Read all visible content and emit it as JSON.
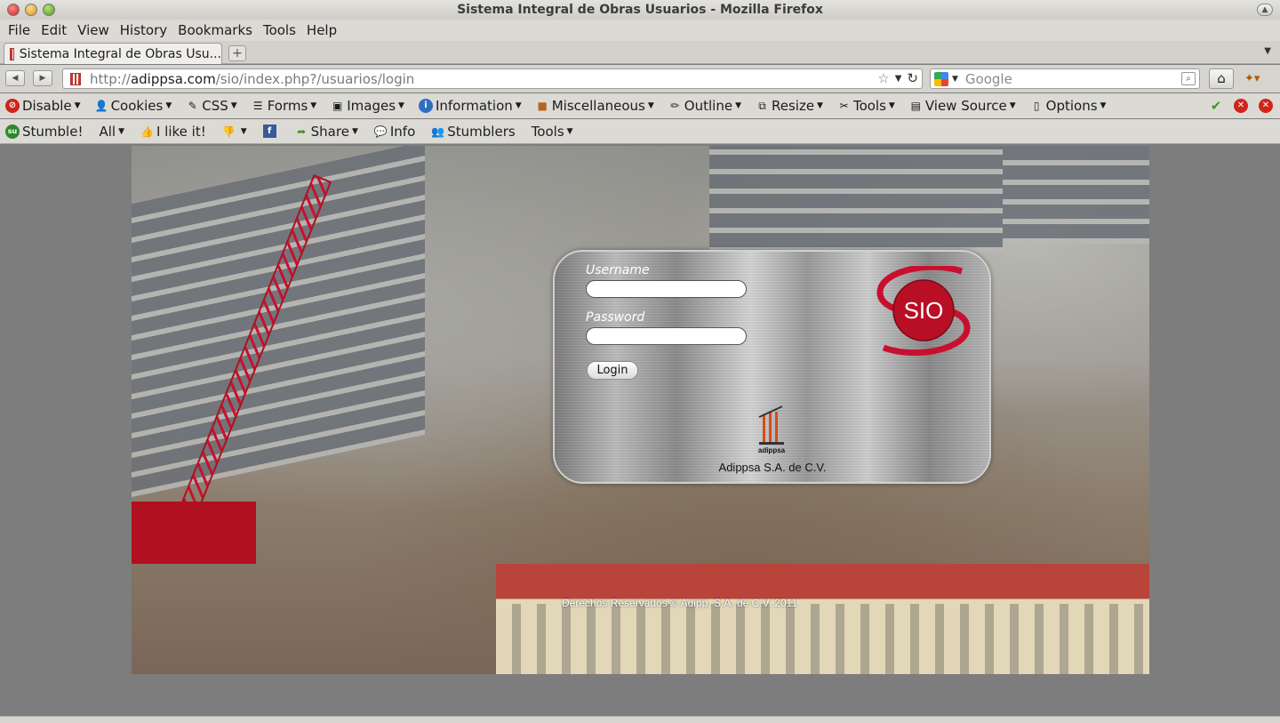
{
  "window": {
    "title": "Sistema Integral de Obras Usuarios - Mozilla Firefox"
  },
  "menu": [
    "File",
    "Edit",
    "View",
    "History",
    "Bookmarks",
    "Tools",
    "Help"
  ],
  "tab": {
    "label": "Sistema Integral de Obras Usu...",
    "new_tab": "+"
  },
  "address": {
    "prefix": "http://",
    "domain": "adippsa.com",
    "path": "/sio/index.php?/usuarios/login"
  },
  "search": {
    "placeholder": "Google"
  },
  "web_developer_toolbar": [
    "Disable",
    "Cookies",
    "CSS",
    "Forms",
    "Images",
    "Information",
    "Miscellaneous",
    "Outline",
    "Resize",
    "Tools",
    "View Source",
    "Options"
  ],
  "stumble_toolbar": {
    "stumble": "Stumble!",
    "all": "All",
    "like": "I like it!",
    "share": "Share",
    "info": "Info",
    "stumblers": "Stumblers",
    "tools": "Tools"
  },
  "login": {
    "username_label": "Username",
    "password_label": "Password",
    "login_button": "Login",
    "logo_text": "SIO",
    "company_logo_text": "adippsa",
    "company_name": "Adippsa S.A. de C.V."
  },
  "footer": {
    "copyright": "Derechos Reservados © Adipp, S.A. de C.V. 2011"
  },
  "colors": {
    "brand_red": "#c8102e",
    "browser_chrome": "#dcdad5",
    "page_bg": "#7d7d7d"
  }
}
